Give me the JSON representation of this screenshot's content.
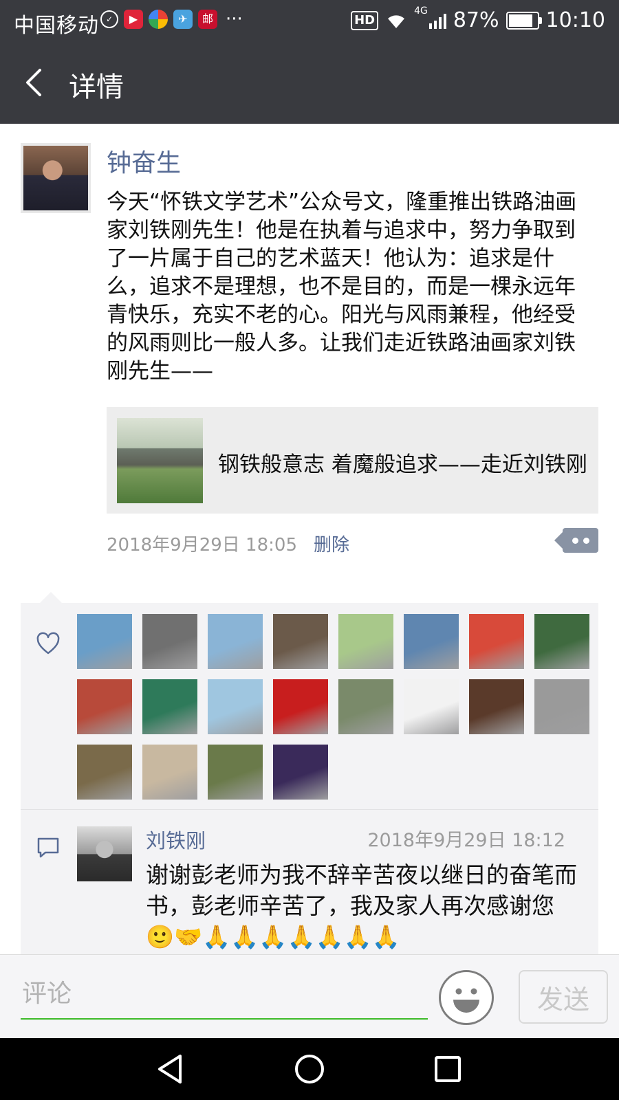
{
  "status_bar": {
    "carrier": "中国移动",
    "battery": "87%",
    "time": "10:10",
    "network": "4G",
    "hd": "HD",
    "notification_icons": [
      "shield-icon",
      "video-app-icon",
      "browser-app-icon",
      "telegram-icon",
      "post-app-icon"
    ],
    "more": "···"
  },
  "header": {
    "title": "详情"
  },
  "post": {
    "author": "钟奋生",
    "text": "今天“怀铁文学艺术”公众号文，隆重推出铁路油画家刘铁刚先生！他是在执着与追求中，努力争取到了一片属于自己的艺术蓝天！他认为：追求是什么，追求不是理想，也不是目的，而是一棵永远年青快乐，充实不老的心。阳光与风雨兼程，他经受的风雨则比一般人多。让我们走近铁路油画家刘铁刚先生——",
    "link_title": "钢铁般意志 着魔般追求——走近刘铁刚",
    "time": "2018年9月29日 18:05",
    "delete_label": "删除"
  },
  "likes": {
    "count": 20,
    "avatar_colors": [
      "#6a9ec8",
      "#707070",
      "#8ab4d6",
      "#6b5a4a",
      "#a8c88a",
      "#5f86b0",
      "#d84a3a",
      "#3f6a3f",
      "#b84a3a",
      "#2e7a5a",
      "#9fc6e0",
      "#c81e1e",
      "#7a8a6a",
      "#f2f2f2",
      "#5a3a2a",
      "#9a9a9a",
      "#7a6a4a",
      "#c8b8a0",
      "#6a7a4a",
      "#3a2a5a"
    ]
  },
  "comments": [
    {
      "name": "刘铁刚",
      "time": "2018年9月29日 18:12",
      "text": "谢谢彭老师为我不辞辛苦夜以继日的奋笔而书，彭老师辛苦了，我及家人再次感谢您🙂🤝🙏🙏🙏🙏🙏🙏🙏"
    }
  ],
  "input": {
    "placeholder": "评论",
    "send_label": "发送"
  },
  "colors": {
    "bar_bg": "#393a3f",
    "link_blue": "#576b95",
    "accent_green": "#3dbb2a"
  }
}
